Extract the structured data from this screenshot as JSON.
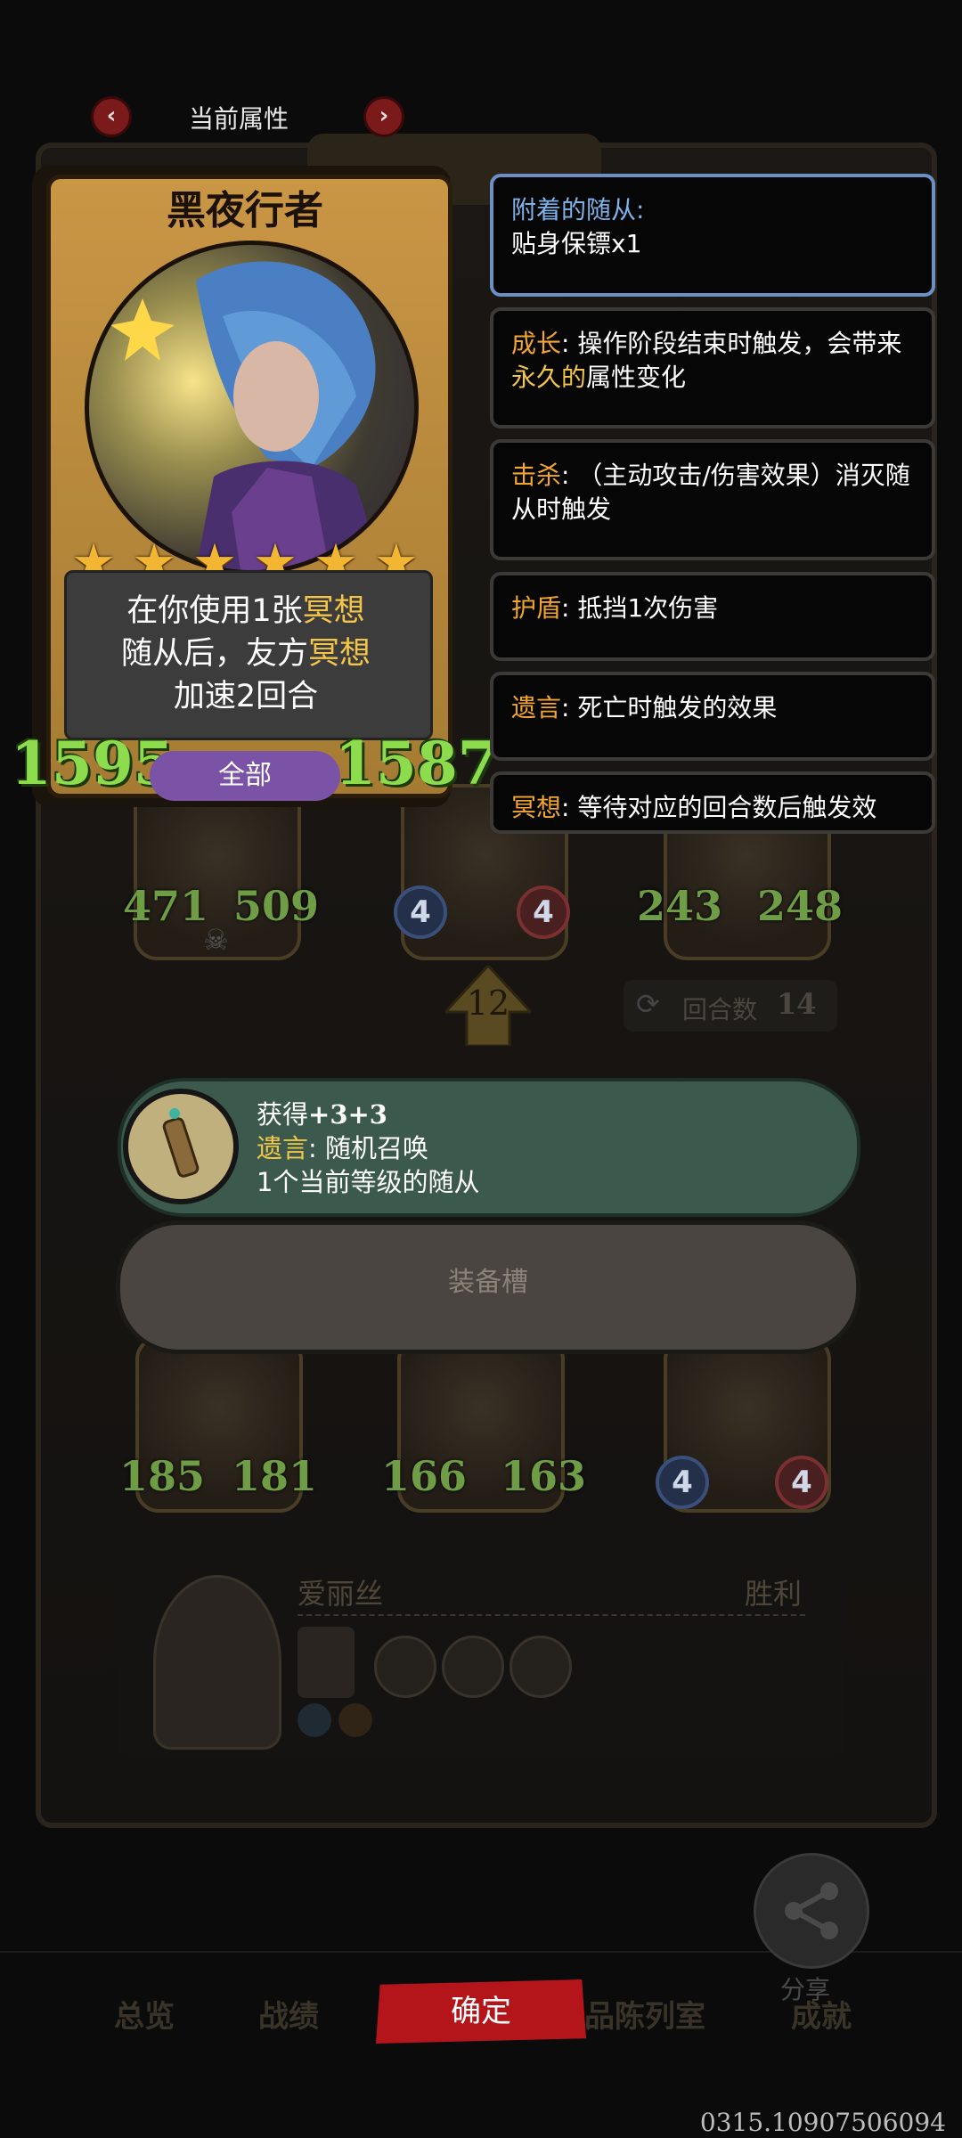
{
  "nav": {
    "title": "当前属性",
    "prev_icon": "‹",
    "next_icon": "›"
  },
  "card": {
    "name": "黑夜行者",
    "stars": 6,
    "description": {
      "line1_a": "在你使用1张",
      "line1_hl": "冥想",
      "line2_a": "随从后，友方",
      "line2_hl": "冥想",
      "line3": "加速2回合"
    },
    "attack": "1595",
    "health": "1587",
    "filter_label": "全部"
  },
  "keywords": {
    "attached": {
      "title": "附着的随从:",
      "value": "贴身保镖x1"
    },
    "growth": {
      "title": "成长",
      "text_a": ": 操作阶段结束时触发，会带来",
      "text_hl": "永久的",
      "text_b": "属性变化"
    },
    "kill": {
      "title": "击杀",
      "text": ": （主动攻击/伤害效果）消灭随从时触发"
    },
    "shield": {
      "title": "护盾",
      "text": ": 抵挡1次伤害"
    },
    "deathrattle": {
      "title": "遗言",
      "text": ": 死亡时触发的效果"
    },
    "meditate": {
      "title": "冥想",
      "text": ": 等待对应的回合数后触发效"
    }
  },
  "loot": {
    "line1_a": "获得",
    "line1_b": "+3+3",
    "line2_hl": "遗言",
    "line2_rest": ":   随机召唤",
    "line3": "1个当前等级的随从"
  },
  "equip_slot": {
    "label": "装备槽"
  },
  "board": {
    "row1": [
      {
        "atk": "471",
        "hp": "509"
      },
      {
        "atk": "4",
        "hp": "4"
      },
      {
        "atk": "243",
        "hp": "248"
      }
    ],
    "level_badge": "12",
    "turn_label": "回合数",
    "turn_value": "14",
    "row3": [
      {
        "atk": "185",
        "hp": "181"
      },
      {
        "atk": "166",
        "hp": "163"
      },
      {
        "atk": "4",
        "hp": "4"
      }
    ],
    "opponent_name": "爱丽丝",
    "result": "胜利"
  },
  "bottom": {
    "tabs": [
      "总览",
      "战绩",
      "品陈列室",
      "成就"
    ],
    "confirm_label": "确定",
    "share_label": "分享"
  },
  "footer": {
    "version": "0315.10907506094"
  },
  "colors": {
    "accent_red": "#b3151a",
    "keyword_orange": "#f3a62e",
    "highlight_gold": "#f3c64a",
    "stat_green": "#8ddc4e"
  }
}
